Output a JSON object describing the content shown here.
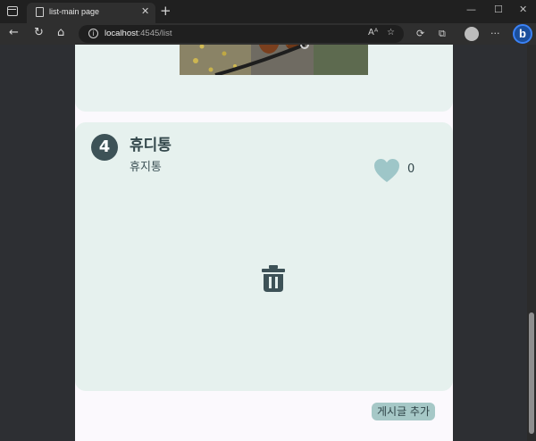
{
  "browser": {
    "tab_title": "list-main page",
    "url_host": "localhost",
    "url_rest": ":4545/list"
  },
  "post": {
    "number": "4",
    "title": "휴디통",
    "subtitle": "휴지통",
    "like_count": "0"
  },
  "add_button_label": "게시글 추가",
  "colors": {
    "card_bg": "#e6f1ee",
    "badge_bg": "#3d5257",
    "heart": "#9ec6c8",
    "button_bg": "#a6c8c7"
  }
}
